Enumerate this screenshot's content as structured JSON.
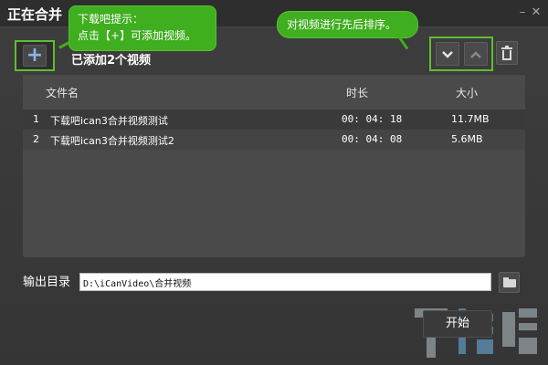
{
  "window": {
    "title": "正在合并"
  },
  "tooltips": {
    "add_title": "下载吧提示：",
    "add_body": "点击【+】可添加视频。",
    "sort": "对视频进行先后排序。"
  },
  "toolbar": {
    "add_symbol": "+",
    "added_count": "已添加2个视频"
  },
  "table": {
    "columns": [
      "文件名",
      "时长",
      "大小"
    ],
    "rows": [
      {
        "index": "1",
        "name": "下载吧ican3合并视频测试",
        "duration": "00: 04: 18",
        "size": "11.7MB"
      },
      {
        "index": "2",
        "name": "下载吧ican3合并视频测试2",
        "duration": "00: 04: 08",
        "size": "5.6MB"
      }
    ]
  },
  "output": {
    "label": "输出目录",
    "path": "D:\\iCanVideo\\合并视频"
  },
  "actions": {
    "start_label": "开始"
  },
  "icons": {
    "sort_down": "chevron-down-icon",
    "sort_up": "chevron-up-icon",
    "delete": "trash-icon",
    "browse": "folder-icon",
    "minimize": "minimize-icon",
    "close": "close-icon"
  },
  "colors": {
    "highlight_green": "#5fbe2f",
    "tooltip_green": "#3fae1f",
    "panel_gray": "#4a4a4a"
  }
}
